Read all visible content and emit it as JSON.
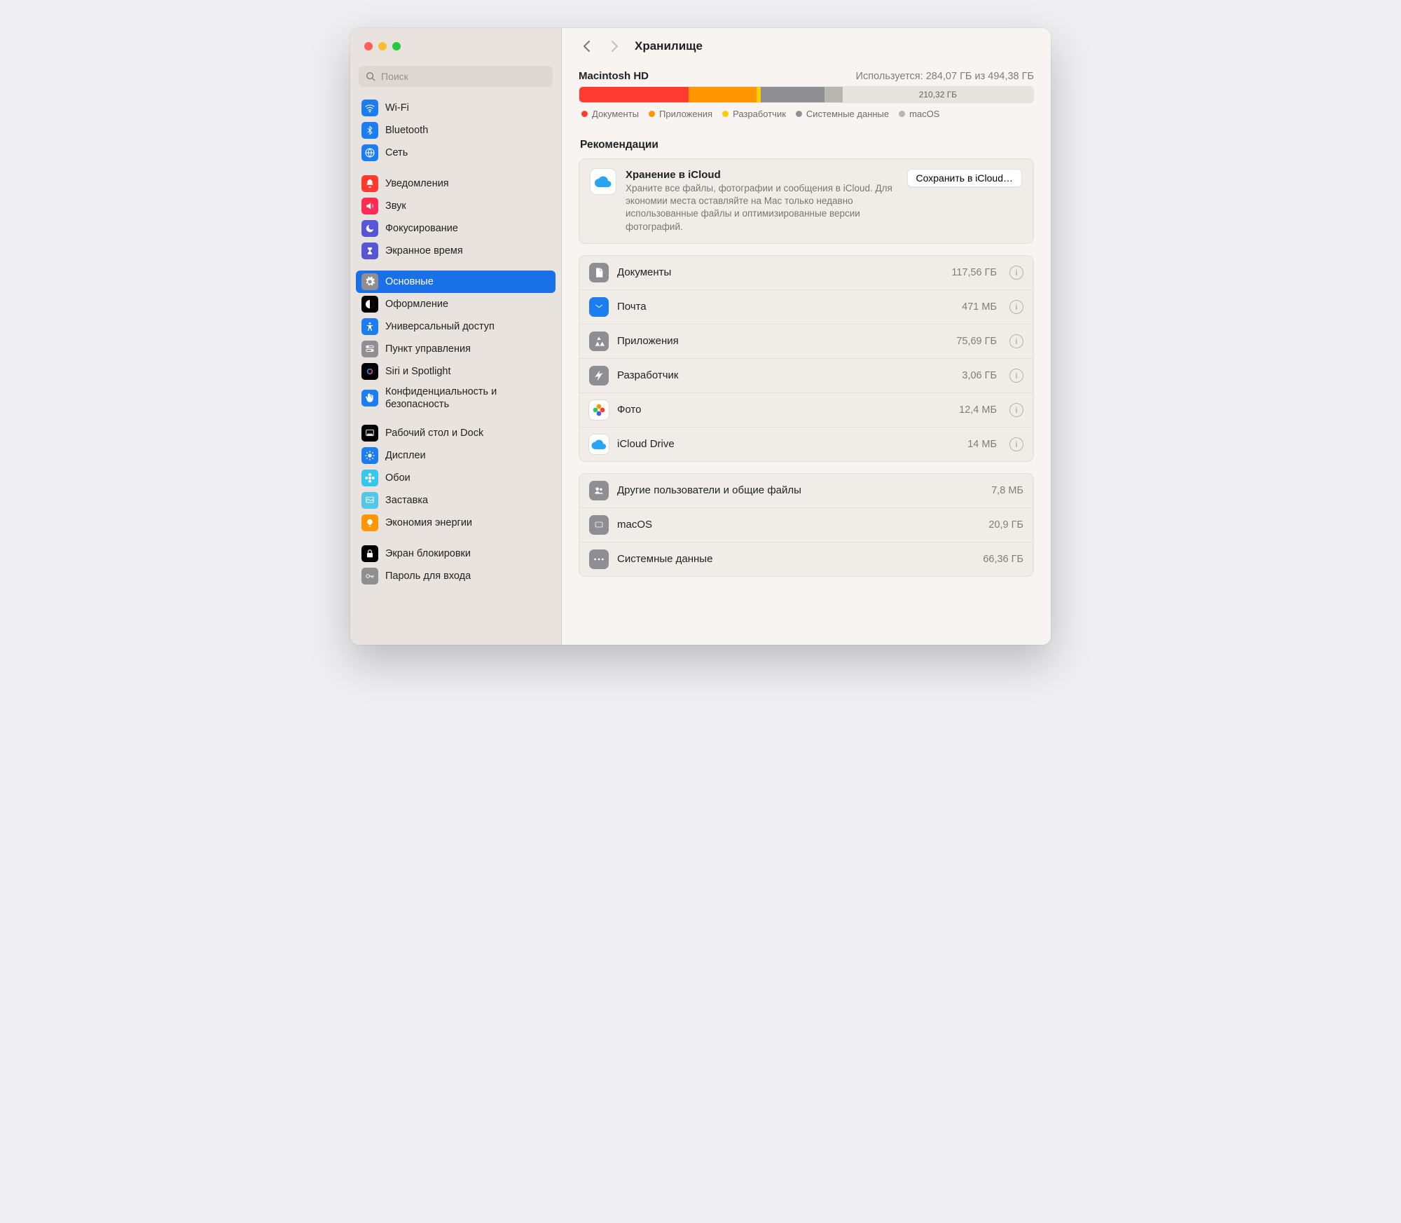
{
  "header": {
    "title": "Хранилище"
  },
  "search": {
    "placeholder": "Поиск"
  },
  "sidebar_groups": [
    {
      "items": [
        {
          "name": "wifi",
          "label": "Wi-Fi",
          "icon": "wifi",
          "bg": "#1b7df0"
        },
        {
          "name": "bluetooth",
          "label": "Bluetooth",
          "icon": "bluetooth",
          "bg": "#1b7df0"
        },
        {
          "name": "network",
          "label": "Сеть",
          "icon": "globe",
          "bg": "#1b7df0"
        }
      ]
    },
    {
      "items": [
        {
          "name": "notifications",
          "label": "Уведомления",
          "icon": "bell",
          "bg": "#ff3b30"
        },
        {
          "name": "sound",
          "label": "Звук",
          "icon": "sound",
          "bg": "#ff2d55"
        },
        {
          "name": "focus",
          "label": "Фокусирование",
          "icon": "moon",
          "bg": "#5856d6"
        },
        {
          "name": "screentime",
          "label": "Экранное время",
          "icon": "hourglass",
          "bg": "#5856d6"
        }
      ]
    },
    {
      "items": [
        {
          "name": "general",
          "label": "Основные",
          "icon": "gear",
          "bg": "#8e8e93",
          "selected": true
        },
        {
          "name": "appearance",
          "label": "Оформление",
          "icon": "appearance",
          "bg": "#000000"
        },
        {
          "name": "accessibility",
          "label": "Универсальный доступ",
          "icon": "access",
          "bg": "#1b7df0"
        },
        {
          "name": "controlcenter",
          "label": "Пункт управления",
          "icon": "switches",
          "bg": "#8e8e93"
        },
        {
          "name": "siri",
          "label": "Siri и Spotlight",
          "icon": "siri",
          "bg": "#000000"
        },
        {
          "name": "privacy",
          "label": "Конфиденциальность и безопасность",
          "icon": "hand",
          "bg": "#1b7df0"
        }
      ]
    },
    {
      "items": [
        {
          "name": "desktop",
          "label": "Рабочий стол и Dock",
          "icon": "dock",
          "bg": "#000000"
        },
        {
          "name": "displays",
          "label": "Дисплеи",
          "icon": "sun",
          "bg": "#1b7df0"
        },
        {
          "name": "wallpaper",
          "label": "Обои",
          "icon": "flower",
          "bg": "#34c8ec"
        },
        {
          "name": "screensaver",
          "label": "Заставка",
          "icon": "screensaver",
          "bg": "#54c6e6"
        },
        {
          "name": "energy",
          "label": "Экономия энергии",
          "icon": "bulb",
          "bg": "#ff9500"
        }
      ]
    },
    {
      "items": [
        {
          "name": "lockscreen",
          "label": "Экран блокировки",
          "icon": "lock",
          "bg": "#000000"
        },
        {
          "name": "loginpass",
          "label": "Пароль для входа",
          "icon": "key",
          "bg": "#8e8e93"
        }
      ]
    }
  ],
  "disk": {
    "name": "Macintosh HD",
    "used_text": "Используется: 284,07 ГБ из 494,38 ГБ",
    "free_label": "210,32 ГБ",
    "segments": [
      {
        "name": "docs",
        "label": "Документы",
        "color": "#ff3b30",
        "pct": 24
      },
      {
        "name": "apps",
        "label": "Приложения",
        "color": "#ff9500",
        "pct": 15
      },
      {
        "name": "dev",
        "label": "Разработчик",
        "color": "#ffcc00",
        "pct": 1
      },
      {
        "name": "sys",
        "label": "Системные данные",
        "color": "#8e8e93",
        "pct": 14
      },
      {
        "name": "macos",
        "label": "macOS",
        "color": "#b8b6b1",
        "pct": 4
      }
    ]
  },
  "recommendations": {
    "section_title": "Рекомендации",
    "item": {
      "title": "Хранение в iCloud",
      "desc": "Храните все файлы, фотографии и сообщения в iCloud. Для экономии места оставляйте на Mac только недавно использованные файлы и оптимизированные версии фотографий.",
      "button": "Сохранить в iCloud…"
    }
  },
  "categories": [
    [
      {
        "name": "documents",
        "label": "Документы",
        "size": "117,56 ГБ",
        "bg": "#8e8e93",
        "info": true
      },
      {
        "name": "mail",
        "label": "Почта",
        "size": "471 МБ",
        "bg": "#1b7df0",
        "info": true
      },
      {
        "name": "applications",
        "label": "Приложения",
        "size": "75,69 ГБ",
        "bg": "#8e8e93",
        "info": true
      },
      {
        "name": "developer",
        "label": "Разработчик",
        "size": "3,06 ГБ",
        "bg": "#8e8e93",
        "info": true
      },
      {
        "name": "photos",
        "label": "Фото",
        "size": "12,4 МБ",
        "bg": "#ffffff",
        "info": true,
        "border": true
      },
      {
        "name": "icloud",
        "label": "iCloud Drive",
        "size": "14 МБ",
        "bg": "#ffffff",
        "info": true,
        "border": true
      }
    ],
    [
      {
        "name": "otherusers",
        "label": "Другие пользователи и общие файлы",
        "size": "7,8 МБ",
        "bg": "#8e8e93",
        "info": false
      },
      {
        "name": "macos",
        "label": "macOS",
        "size": "20,9 ГБ",
        "bg": "#8e8e93",
        "info": false
      },
      {
        "name": "systemdata",
        "label": "Системные данные",
        "size": "66,36 ГБ",
        "bg": "#8e8e93",
        "info": false
      }
    ]
  ],
  "icons": {}
}
